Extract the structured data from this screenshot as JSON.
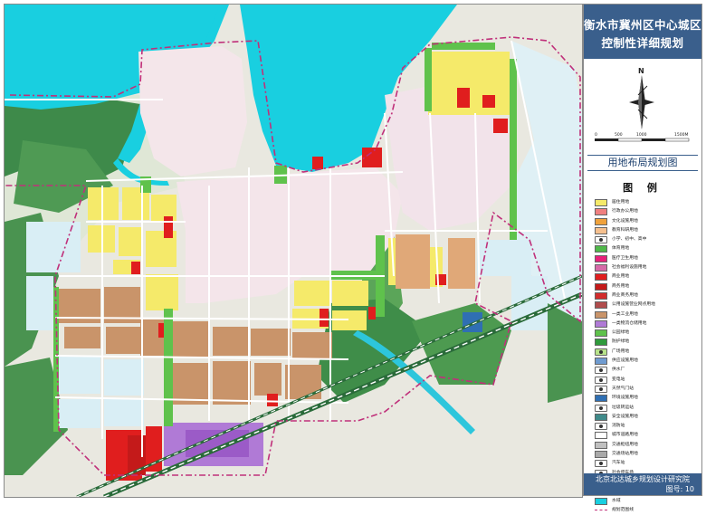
{
  "title": {
    "line1": "衡水市冀州区中心城区",
    "line2": "控制性详细规划"
  },
  "subtitle": "用地布局规划图",
  "compass_label": "N",
  "scale_bar": {
    "ticks": [
      "0",
      "500",
      "1000",
      "1500M"
    ]
  },
  "legend": {
    "heading": "图 例",
    "items": [
      {
        "label": "居住用地",
        "color": "#f5ea6a",
        "kind": "fill"
      },
      {
        "label": "行政办公用地",
        "color": "#f08080",
        "kind": "fill"
      },
      {
        "label": "文化设施用地",
        "color": "#f0a23c",
        "kind": "fill"
      },
      {
        "label": "教育科研用地",
        "color": "#f6c08e",
        "kind": "fill"
      },
      {
        "label": "小学、初中、高中",
        "color": "#ffffff",
        "kind": "symbol"
      },
      {
        "label": "体育用地",
        "color": "#4fb849",
        "kind": "fill"
      },
      {
        "label": "医疗卫生用地",
        "color": "#e8207a",
        "kind": "fill"
      },
      {
        "label": "社会福利设施用地",
        "color": "#d66aa8",
        "kind": "fill"
      },
      {
        "label": "商业用地",
        "color": "#e01e1e",
        "kind": "fill"
      },
      {
        "label": "商务用地",
        "color": "#c41a1a",
        "kind": "fill"
      },
      {
        "label": "商业商务用地",
        "color": "#d22c2c",
        "kind": "fill"
      },
      {
        "label": "公用设施营业网点用地",
        "color": "#b04c4c",
        "kind": "fill"
      },
      {
        "label": "一类工业用地",
        "color": "#c9946a",
        "kind": "fill"
      },
      {
        "label": "一类物流仓储用地",
        "color": "#b07ad6",
        "kind": "fill"
      },
      {
        "label": "公园绿地",
        "color": "#5fc24c",
        "kind": "fill"
      },
      {
        "label": "防护绿地",
        "color": "#2f9a3c",
        "kind": "fill"
      },
      {
        "label": "广场用地",
        "color": "#b8e38a",
        "kind": "symbol"
      },
      {
        "label": "供应设施用地",
        "color": "#6f9bd0",
        "kind": "fill"
      },
      {
        "label": "供水厂",
        "color": "#ffffff",
        "kind": "symbol"
      },
      {
        "label": "变电站",
        "color": "#ffffff",
        "kind": "symbol"
      },
      {
        "label": "天然气门站",
        "color": "#ffffff",
        "kind": "symbol"
      },
      {
        "label": "环境设施用地",
        "color": "#2f6fb3",
        "kind": "fill"
      },
      {
        "label": "垃圾转运站",
        "color": "#ffffff",
        "kind": "symbol"
      },
      {
        "label": "安全设施用地",
        "color": "#3f8a8a",
        "kind": "fill"
      },
      {
        "label": "消防站",
        "color": "#ffffff",
        "kind": "symbol"
      },
      {
        "label": "城市道路用地",
        "color": "#ffffff",
        "kind": "fill"
      },
      {
        "label": "交通枢纽用地",
        "color": "#c0c0c0",
        "kind": "fill"
      },
      {
        "label": "交通场站用地",
        "color": "#a9a9a9",
        "kind": "fill"
      },
      {
        "label": "汽车站",
        "color": "#ffffff",
        "kind": "symbol"
      },
      {
        "label": "社会停车场",
        "color": "#ffffff",
        "kind": "symbol"
      },
      {
        "label": "加油站",
        "color": "#ffffff",
        "kind": "symbol"
      },
      {
        "label": "铁路线",
        "color": "#2a6b3a",
        "kind": "line"
      },
      {
        "label": "水域",
        "color": "#19cfe0",
        "kind": "fill"
      },
      {
        "label": "规划范围线",
        "color": "#c0307a",
        "kind": "dash"
      }
    ]
  },
  "footer": {
    "institute": "北京北达城乡规划设计研究院",
    "figure_number": "图号: 10"
  }
}
